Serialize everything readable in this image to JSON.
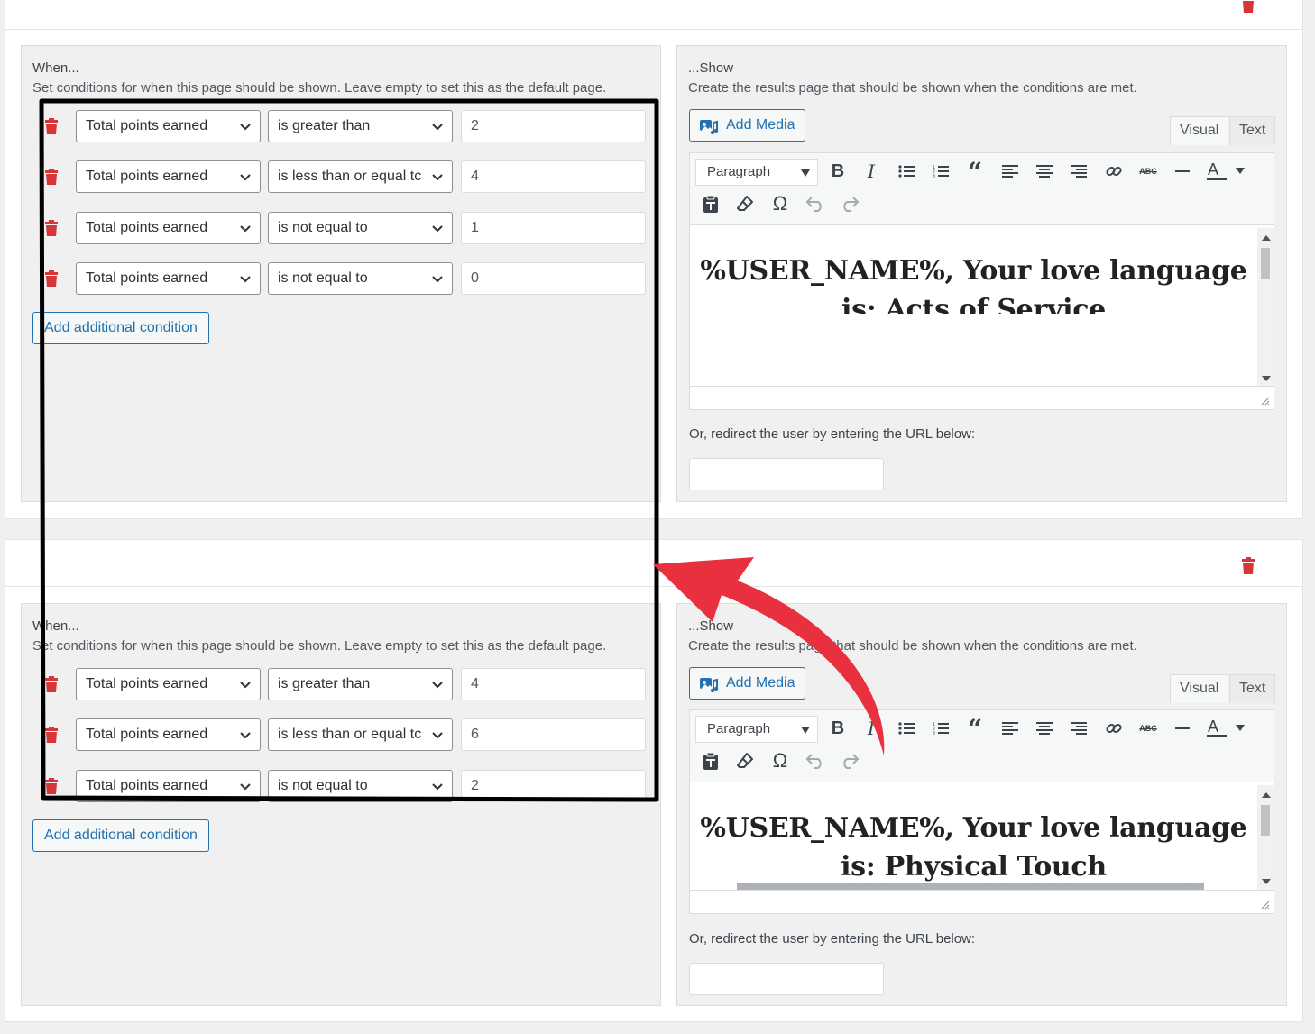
{
  "colors": {
    "accent": "#2271b1",
    "delete": "#d63638",
    "annotation_arrow": "#e8303f",
    "annotation_box": "#000000"
  },
  "blocks": [
    {
      "when": {
        "title": "When...",
        "description": "Set conditions for when this page should be shown. Leave empty to set this as the default page.",
        "conditions": [
          {
            "field": "Total points earned",
            "operator": "is greater than",
            "value": "2"
          },
          {
            "field": "Total points earned",
            "operator": "is less than or equal tc",
            "value": "4"
          },
          {
            "field": "Total points earned",
            "operator": "is not equal to",
            "value": "1"
          },
          {
            "field": "Total points earned",
            "operator": "is not equal to",
            "value": "0"
          }
        ],
        "add_condition_label": "Add additional condition"
      },
      "show": {
        "title": "...Show",
        "description": "Create the results page that should be shown when the conditions are met.",
        "add_media_label": "Add Media",
        "tab_visual": "Visual",
        "tab_text": "Text",
        "format_select": "Paragraph",
        "heading": "%USER_NAME%, Your love language is: Acts of Service",
        "redirect_label": "Or, redirect the user by entering the URL below:",
        "redirect_value": ""
      }
    },
    {
      "when": {
        "title": "When...",
        "description": "Set conditions for when this page should be shown. Leave empty to set this as the default page.",
        "conditions": [
          {
            "field": "Total points earned",
            "operator": "is greater than",
            "value": "4"
          },
          {
            "field": "Total points earned",
            "operator": "is less than or equal tc",
            "value": "6"
          },
          {
            "field": "Total points earned",
            "operator": "is not equal to",
            "value": "2"
          }
        ],
        "add_condition_label": "Add additional condition"
      },
      "show": {
        "title": "...Show",
        "description": "Create the results page that should be shown when the conditions are met.",
        "add_media_label": "Add Media",
        "tab_visual": "Visual",
        "tab_text": "Text",
        "format_select": "Paragraph",
        "heading": "%USER_NAME%, Your love language is: Physical Touch",
        "redirect_label": "Or, redirect the user by entering the URL below:",
        "redirect_value": ""
      }
    }
  ],
  "toolbar_icons": [
    "bold-icon",
    "italic-icon",
    "bulleted-list-icon",
    "numbered-list-icon",
    "blockquote-icon",
    "align-left-icon",
    "align-center-icon",
    "align-right-icon",
    "link-icon",
    "strikethrough-icon",
    "horizontal-line-icon",
    "text-color-icon",
    "paste-text-icon",
    "clear-formatting-icon",
    "special-character-icon",
    "undo-icon",
    "redo-icon"
  ]
}
